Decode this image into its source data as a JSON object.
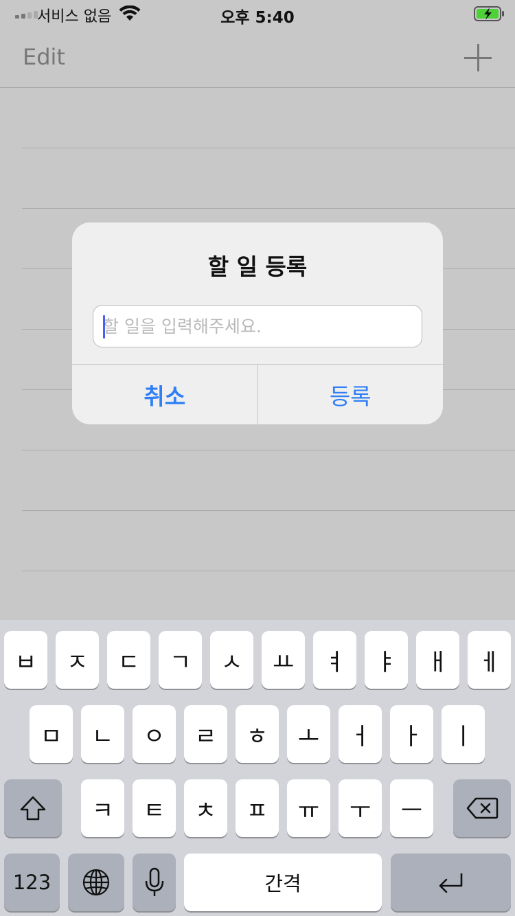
{
  "status_bar": {
    "carrier": "서비스 없음",
    "time": "오후 5:40"
  },
  "nav": {
    "edit_label": "Edit",
    "add_icon": "plus-icon"
  },
  "alert": {
    "title": "할 일 등록",
    "input_placeholder": "할 일을 입력해주세요.",
    "input_value": "",
    "cancel_label": "취소",
    "confirm_label": "등록"
  },
  "keyboard": {
    "row1": [
      "ㅂ",
      "ㅈ",
      "ㄷ",
      "ㄱ",
      "ㅅ",
      "ㅛ",
      "ㅕ",
      "ㅑ",
      "ㅐ",
      "ㅔ"
    ],
    "row2": [
      "ㅁ",
      "ㄴ",
      "ㅇ",
      "ㄹ",
      "ㅎ",
      "ㅗ",
      "ㅓ",
      "ㅏ",
      "ㅣ"
    ],
    "row3": [
      "ㅋ",
      "ㅌ",
      "ㅊ",
      "ㅍ",
      "ㅠ",
      "ㅜ",
      "ㅡ"
    ],
    "numbers_label": "123",
    "space_label": "간격"
  },
  "colors": {
    "accent": "#2f7ff5",
    "dim_background": "#c8c8c8",
    "keyboard_background": "#d2d4d9"
  }
}
